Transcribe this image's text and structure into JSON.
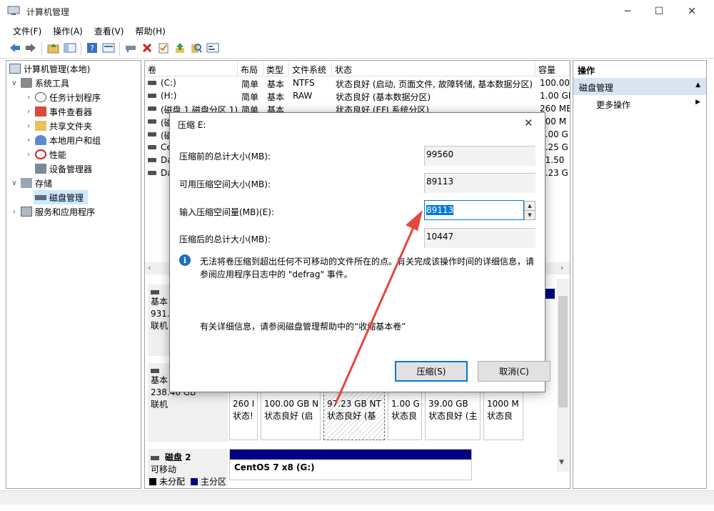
{
  "window": {
    "title": "计算机管理",
    "minimize": "─",
    "maximize": "☐",
    "close": "✕"
  },
  "menu": [
    "文件(F)",
    "操作(A)",
    "查看(V)",
    "帮助(H)"
  ],
  "tree": {
    "root": "计算机管理(本地)",
    "system_tools": "系统工具",
    "task_scheduler": "任务计划程序",
    "event_viewer": "事件查看器",
    "shared_folders": "共享文件夹",
    "local_users": "本地用户和组",
    "performance": "性能",
    "device_manager": "设备管理器",
    "storage": "存储",
    "disk_management": "磁盘管理",
    "services_apps": "服务和应用程序"
  },
  "volume_list": {
    "columns": [
      "卷",
      "布局",
      "类型",
      "文件系统",
      "状态",
      "容量"
    ],
    "rows": [
      [
        "(C:)",
        "简单",
        "基本",
        "NTFS",
        "状态良好 (启动, 页面文件, 故障转储, 基本数据分区)",
        "100.00"
      ],
      [
        "(H:)",
        "简单",
        "基本",
        "RAW",
        "状态良好 (基本数据分区)",
        "1.00 GE"
      ],
      [
        "(磁盘 1 磁盘分区 1)",
        "简单",
        "基本",
        "",
        "状态良好 (EFI 系统分区)",
        "260 ME"
      ],
      [
        "(磁",
        "",
        "",
        "",
        "",
        "000 M"
      ],
      [
        "(磁",
        "",
        "",
        "",
        "",
        "9.00 G"
      ],
      [
        "Ce",
        "",
        "",
        "",
        "",
        "9.25 G"
      ],
      [
        "Da",
        "",
        "",
        "",
        "",
        "31.50"
      ],
      [
        "Da",
        "",
        "",
        "",
        "",
        "7.23 G"
      ]
    ]
  },
  "disks": {
    "disk0": {
      "type": "基本",
      "size": "931.",
      "status": "联机"
    },
    "disk1": {
      "type": "基本",
      "size": "238.46 GB",
      "status": "联机",
      "partitions": [
        {
          "size": "260 I",
          "status": "状态!"
        },
        {
          "size": "100.00 GB N",
          "status": "状态良好 (启"
        },
        {
          "size": "97.23 GB NT",
          "status": "状态良好 (基"
        },
        {
          "size": "1.00 G",
          "status": "状态良"
        },
        {
          "size": "39.00 GB",
          "status": "状态良好 (主"
        },
        {
          "size": "1000 M",
          "status": "状态良"
        }
      ]
    },
    "disk2": {
      "name": "磁盘 2",
      "status": "可移动",
      "volume": "CentOS 7 x8  (G:)"
    }
  },
  "legend": {
    "unallocated": "未分配",
    "primary": "主分区"
  },
  "actions": {
    "header": "操作",
    "section": "磁盘管理",
    "more": "更多操作"
  },
  "dialog": {
    "title": "压缩 E:",
    "label_total_before": "压缩前的总计大小(MB):",
    "value_total_before": "99560",
    "label_available": "可用压缩空间大小(MB):",
    "value_available": "89113",
    "label_input": "输入压缩空间量(MB)(E):",
    "value_input": "89113",
    "label_total_after": "压缩后的总计大小(MB):",
    "value_total_after": "10447",
    "info": "无法将卷压缩到超出任何不可移动的文件所在的点。有关完成该操作时间的详细信息，请参阅应用程序日志中的 \"defrag\" 事件。",
    "help": "有关详细信息，请参阅磁盘管理帮助中的“收缩基本卷”",
    "ok": "压缩(S)",
    "cancel": "取消(C)"
  },
  "colors": {
    "accent": "#0078d7",
    "primary_partition": "#000080",
    "annotation_arrow": "#e8453c"
  }
}
